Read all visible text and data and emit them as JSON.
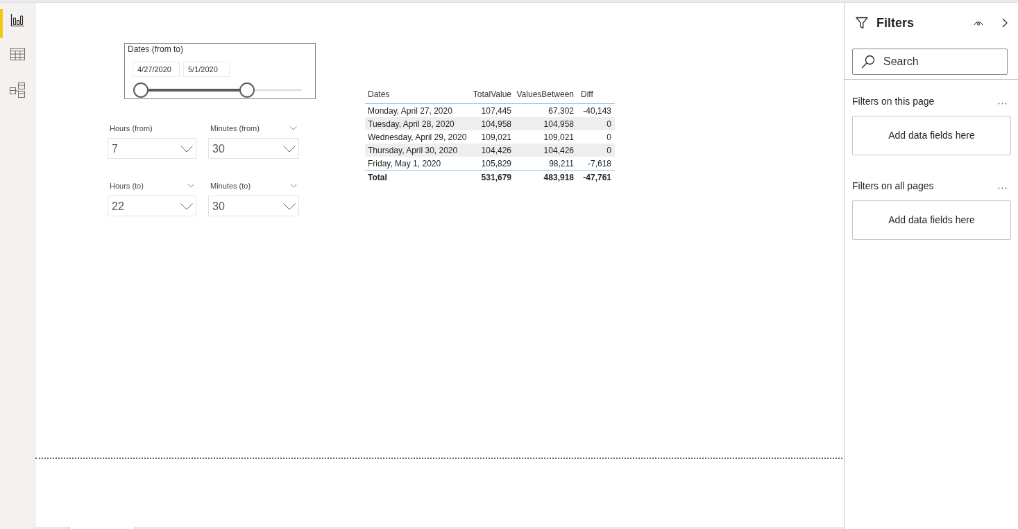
{
  "nav": [
    {
      "kind": "report",
      "selected": true
    },
    {
      "kind": "data",
      "selected": false
    },
    {
      "kind": "model",
      "selected": false
    }
  ],
  "date_slicer": {
    "title": "Dates (from to)",
    "start_value": "4/27/2020",
    "end_value": "5/1/2020",
    "thumbs": [
      {
        "level": 0
      },
      {
        "level": 0.66
      }
    ]
  },
  "dropdown_slicers": [
    {
      "label": "Hours (from)",
      "value": "7",
      "header_chevron": false
    },
    {
      "label": "Minutes (from)",
      "value": "30",
      "header_chevron": true
    },
    {
      "label": "Hours (to)",
      "value": "22",
      "header_chevron": true
    },
    {
      "label": "Minutes (to)",
      "value": "30",
      "header_chevron": true
    }
  ],
  "table": {
    "columns": [
      "Dates",
      "TotalValue",
      "ValuesBetween",
      "Diff"
    ],
    "rows": [
      [
        "Monday, April 27, 2020",
        "107,445",
        "67,302",
        "-40,143"
      ],
      [
        "Tuesday, April 28, 2020",
        "104,958",
        "104,958",
        "0"
      ],
      [
        "Wednesday, April 29, 2020",
        "109,021",
        "109,021",
        "0"
      ],
      [
        "Thursday, April 30, 2020",
        "104,426",
        "104,426",
        "0"
      ],
      [
        "Friday, May 1, 2020",
        "105,829",
        "98,211",
        "-7,618"
      ]
    ],
    "total": [
      "Total",
      "531,679",
      "483,918",
      "-47,761"
    ]
  },
  "filters_pane": {
    "title": "Filters",
    "search": {
      "placeholder": "Search"
    },
    "sections": [
      {
        "title": "Filters on this page",
        "drop_zone": "Add data fields here"
      },
      {
        "title": "Filters on all pages",
        "drop_zone": "Add data fields here"
      }
    ]
  }
}
